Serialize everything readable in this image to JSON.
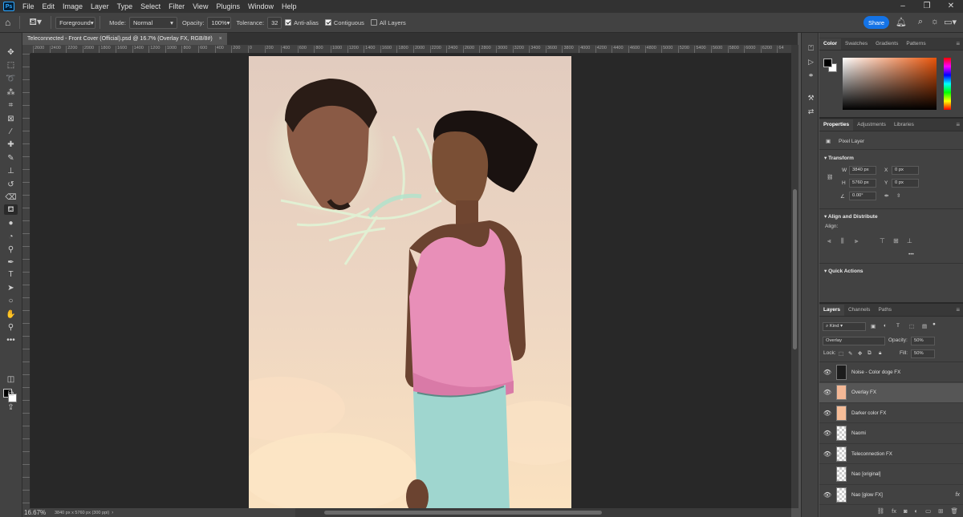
{
  "menubar": {
    "logo": "Ps",
    "items": [
      "File",
      "Edit",
      "Image",
      "Layer",
      "Type",
      "Select",
      "Filter",
      "View",
      "Plugins",
      "Window",
      "Help"
    ],
    "window_controls": [
      "–",
      "❐",
      "✕"
    ]
  },
  "options": {
    "fill_source": "Foreground",
    "mode_label": "Mode:",
    "mode_value": "Normal",
    "opacity_label": "Opacity:",
    "opacity_value": "100%",
    "tolerance_label": "Tolerance:",
    "tolerance_value": "32",
    "anti_alias": "Anti-alias",
    "contiguous": "Contiguous",
    "all_layers": "All Layers",
    "share": "Share"
  },
  "document": {
    "tab_title": "Teleconnected - Front Cover (Official).psd @ 16.7% (Overlay FX, RGB/8#)",
    "tab_close": "×",
    "ruler_ticks": [
      "2600",
      "2400",
      "2200",
      "2000",
      "1800",
      "1600",
      "1400",
      "1200",
      "1000",
      "800",
      "600",
      "400",
      "200",
      "0",
      "200",
      "400",
      "600",
      "800",
      "1000",
      "1200",
      "1400",
      "1600",
      "1800",
      "2000",
      "2200",
      "2400",
      "2600",
      "2800",
      "3000",
      "3200",
      "3400",
      "3600",
      "3800",
      "4000",
      "4200",
      "4400",
      "4600",
      "4800",
      "5000",
      "5200",
      "5400",
      "5600",
      "5800",
      "6000",
      "6200",
      "64"
    ]
  },
  "status": {
    "zoom": "16.67%",
    "doc_info": "3840 px x 5760 px (300 ppi)",
    "arrow": "›"
  },
  "color_panel": {
    "tabs": [
      "Color",
      "Swatches",
      "Gradients",
      "Patterns"
    ],
    "active_tab": 0,
    "fg_color": "#000000",
    "bg_color": "#ffffff"
  },
  "properties": {
    "tabs": [
      "Properties",
      "Adjustments",
      "Libraries"
    ],
    "layer_type": "Pixel Layer",
    "transform_title": "Transform",
    "w_label": "W",
    "w_value": "3840 px",
    "x_label": "X",
    "x_value": "0 px",
    "h_label": "H",
    "h_value": "5760 px",
    "y_label": "Y",
    "y_value": "0 px",
    "angle_value": "0.00°",
    "align_title": "Align and Distribute",
    "align_label": "Align:",
    "more": "•••",
    "quick_actions": "Quick Actions"
  },
  "layers": {
    "tabs": [
      "Layers",
      "Channels",
      "Paths"
    ],
    "kind": "Kind",
    "blend_mode": "Overlay",
    "opacity_label": "Opacity:",
    "opacity_value": "50%",
    "lock_label": "Lock:",
    "fill_label": "Fill:",
    "fill_value": "50%",
    "fx_symbol": "fx",
    "items": [
      {
        "name": "Noise - Color doge FX",
        "visible": true,
        "thumb": "#1c1c1c",
        "selected": false,
        "fx": false
      },
      {
        "name": "Overlay FX",
        "visible": true,
        "thumb": "#f4b896",
        "selected": true,
        "fx": false
      },
      {
        "name": "Darker color FX",
        "visible": true,
        "thumb": "#f6bd98",
        "selected": false,
        "fx": false
      },
      {
        "name": "Naomi",
        "visible": true,
        "thumb": "checker",
        "selected": false,
        "fx": false
      },
      {
        "name": "Teleconnection FX",
        "visible": true,
        "thumb": "checker",
        "selected": false,
        "fx": false
      },
      {
        "name": "Nao [original]",
        "visible": false,
        "thumb": "checker",
        "selected": false,
        "fx": false
      },
      {
        "name": "Nao [glow FX]",
        "visible": true,
        "thumb": "checker",
        "selected": false,
        "fx": true
      }
    ]
  }
}
